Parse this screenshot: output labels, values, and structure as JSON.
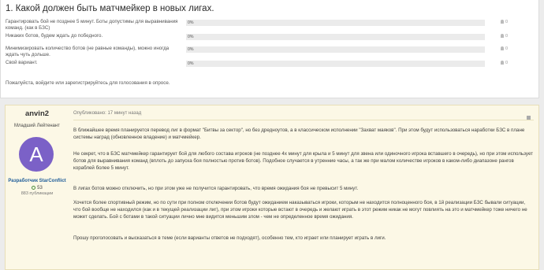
{
  "poll": {
    "title": "1. Какой должен быть матчмейкер в новых лигах.",
    "options": [
      {
        "label": "Гарантировать бой не позднее 5 минут. Боты допустимы для выравнивания команд. (как в БЗС)",
        "percent_text": "0%",
        "percent": 0,
        "votes": "0"
      },
      {
        "label": "Никаких ботов, будем ждать до победного.",
        "percent_text": "0%",
        "percent": 0,
        "votes": "0"
      },
      {
        "label": "Минимизировать количество ботов (не равные команды), можно иногда ждать чуть дольше.",
        "percent_text": "0%",
        "percent": 0,
        "votes": "0"
      },
      {
        "label": "Свой вариант.",
        "percent_text": "0%",
        "percent": 0,
        "votes": "0"
      }
    ],
    "footer_text": "Пожалуйста, войдите или зарегистрируйтесь для голосования в опросе."
  },
  "post": {
    "author": {
      "name": "anvin2",
      "title": "Младший Лейтенант",
      "avatar_letter": "A",
      "avatar_color": "#7b61c7",
      "badge": "Разработчик StarConflict",
      "reputation": "53",
      "publications": "883 публикации"
    },
    "meta": "Опубликовано: 17 минут назад",
    "paragraphs": [
      "В ближайшее время планируется перевод лиг в формат \"Битвы за сектор\", но без дредноутов, а в классическом исполнении \"Захват маяков\". При этом будут использоваться наработки БЗС в плане системы наград (обновленное владение) и матчмейкер.",
      "Не секрет, что в БЗС матчмейкер гарантирует бой для любого состава игроков (не позднее 4х минут для крыла и 5 минут для звена или одиночного игрока вставшего в очередь), но при этом использует ботов для выравнивания команд (вплоть до запуска боя полностью против ботов). Подобное случается в утренние часы, а так же при малом количестве игроков в каком-либо диапазоне рангов кораблей более 5 минут.",
      "В лигах ботов можно отключить, но при этом уже не получится гарантировать, что время ожидания боя не превысит 5 минут.",
      "Хочется более спортивный режим, но по сути при полном отключении ботов будут ожиданием наказываться игроки, которым не находится полноценного боя, в 1й реализации БЗС бывали ситуации, что бой вообще не находился (как и в текущей реализации лиг), при этом игроки которые встают в очередь и желают играть в этот режим никак не могут повлиять на это и матчмейкер тоже ничего не может сделать. Бой с ботами в такой ситуации лично мне видится меньшим злом - чем не определенное время ожидания.",
      "Прошу проголосовать и высказаться в теме (если варианты ответов не подходят), особенно тем, кто играет или планирует играть в лиги."
    ]
  },
  "colors": {
    "bar_fill": "#4a9ad4",
    "post_bg": "#fcf8e6",
    "badge": "#1f5d99"
  }
}
